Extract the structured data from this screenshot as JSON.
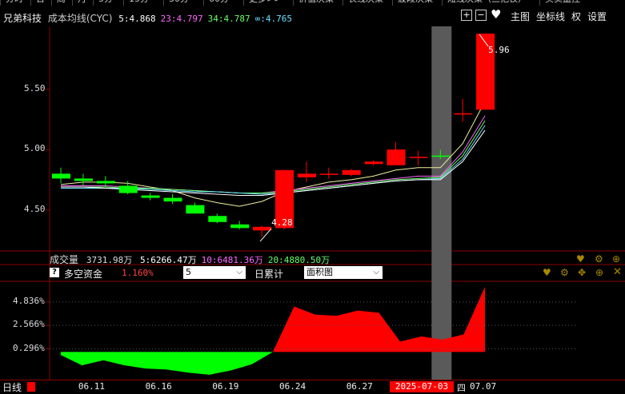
{
  "top_tabs": [
    "分时",
    "日",
    "周",
    "月",
    "5分",
    "15分",
    "30分",
    "60分",
    "更多>>",
    "价值决策",
    "长线决策",
    "波段决策",
    "短线决策（三把钗）",
    "买卖监控"
  ],
  "header": {
    "stock_name": "兄弟科技",
    "indicator_name": "成本均线(CYC)",
    "legend": [
      {
        "label": "5:4.868",
        "color": "#ffffff"
      },
      {
        "label": "23:4.797",
        "color": "#ff66ff"
      },
      {
        "label": "34:4.787",
        "color": "#66ff66"
      },
      {
        "label": "∞:4.765",
        "color": "#66e0ff"
      }
    ],
    "right_controls": {
      "plus": "+",
      "minus": "−",
      "heart": "♥",
      "main_chart": "主图",
      "axis": "坐标线",
      "rights": "权",
      "settings": "设置"
    }
  },
  "price_axis": {
    "labels": [
      "5.50",
      "5.00",
      "4.50"
    ]
  },
  "annotations": {
    "high": "5.96",
    "low": "4.28"
  },
  "volume": {
    "title": "成交量",
    "value": "3731.98万",
    "items": [
      {
        "label": "5:6266.47万",
        "color": "#ffffff"
      },
      {
        "label": "10:6481.36万",
        "color": "#ff66ff"
      },
      {
        "label": "20:4880.50万",
        "color": "#66ff66"
      }
    ]
  },
  "indicator": {
    "help": "?",
    "name": "多空资金",
    "value": "1.160%",
    "param": "5",
    "mode_label": "日累计",
    "chart_type": "面积图",
    "yaxis": [
      "4.836%",
      "2.566%",
      "0.296%"
    ]
  },
  "bottom": {
    "period_label": "日线",
    "dates": [
      "06.11",
      "06.16",
      "06.19",
      "06.24",
      "06.27"
    ],
    "selected_date": "2025-07-03",
    "selected_weekday": "四",
    "next_date": "07.07"
  },
  "colors": {
    "up": "#ff0000",
    "down": "#00ff00",
    "highlight": "#5a5a5a",
    "grid": "#8a0000"
  },
  "chart_data": {
    "type": "candlestick",
    "candles": [
      {
        "o": 4.8,
        "h": 4.85,
        "l": 4.72,
        "c": 4.76
      },
      {
        "o": 4.76,
        "h": 4.8,
        "l": 4.7,
        "c": 4.74
      },
      {
        "o": 4.74,
        "h": 4.78,
        "l": 4.69,
        "c": 4.72
      },
      {
        "o": 4.7,
        "h": 4.74,
        "l": 4.63,
        "c": 4.64
      },
      {
        "o": 4.62,
        "h": 4.64,
        "l": 4.58,
        "c": 4.6
      },
      {
        "o": 4.6,
        "h": 4.63,
        "l": 4.55,
        "c": 4.57
      },
      {
        "o": 4.54,
        "h": 4.56,
        "l": 4.47,
        "c": 4.47
      },
      {
        "o": 4.45,
        "h": 4.47,
        "l": 4.39,
        "c": 4.4
      },
      {
        "o": 4.38,
        "h": 4.41,
        "l": 4.34,
        "c": 4.35
      },
      {
        "o": 4.33,
        "h": 4.37,
        "l": 4.28,
        "c": 4.36
      },
      {
        "o": 4.35,
        "h": 4.83,
        "l": 4.34,
        "c": 4.83
      },
      {
        "o": 4.77,
        "h": 4.9,
        "l": 4.73,
        "c": 4.8
      },
      {
        "o": 4.79,
        "h": 4.85,
        "l": 4.76,
        "c": 4.8
      },
      {
        "o": 4.79,
        "h": 4.84,
        "l": 4.78,
        "c": 4.83
      },
      {
        "o": 4.88,
        "h": 4.91,
        "l": 4.87,
        "c": 4.9
      },
      {
        "o": 4.87,
        "h": 5.06,
        "l": 4.87,
        "c": 5.0
      },
      {
        "o": 4.93,
        "h": 4.99,
        "l": 4.87,
        "c": 4.94
      },
      {
        "o": 4.95,
        "h": 5.0,
        "l": 4.92,
        "c": 4.94
      },
      {
        "o": 5.3,
        "h": 5.42,
        "l": 5.23,
        "c": 5.3
      },
      {
        "o": 5.33,
        "h": 5.96,
        "l": 5.33,
        "c": 5.96
      }
    ],
    "ma_lines": [
      {
        "name": "5",
        "color": "#f0f0a0",
        "values": [
          4.71,
          4.73,
          4.73,
          4.72,
          4.69,
          4.66,
          4.6,
          4.56,
          4.53,
          4.57,
          4.65,
          4.69,
          4.73,
          4.75,
          4.78,
          4.83,
          4.85,
          4.85,
          5.05,
          5.4
        ]
      },
      {
        "name": "23",
        "color": "#ff66ff",
        "values": [
          4.7,
          4.7,
          4.7,
          4.69,
          4.68,
          4.67,
          4.66,
          4.65,
          4.64,
          4.64,
          4.66,
          4.68,
          4.7,
          4.72,
          4.74,
          4.76,
          4.78,
          4.78,
          4.98,
          5.28
        ]
      },
      {
        "name": "34",
        "color": "#66ff66",
        "values": [
          4.69,
          4.69,
          4.69,
          4.68,
          4.68,
          4.67,
          4.66,
          4.65,
          4.64,
          4.64,
          4.65,
          4.67,
          4.69,
          4.71,
          4.73,
          4.75,
          4.76,
          4.77,
          4.95,
          5.24
        ]
      },
      {
        "name": "∞",
        "color": "#66e0ff",
        "values": [
          4.68,
          4.68,
          4.68,
          4.68,
          4.67,
          4.66,
          4.65,
          4.65,
          4.64,
          4.63,
          4.64,
          4.66,
          4.68,
          4.7,
          4.72,
          4.74,
          4.75,
          4.76,
          4.92,
          5.2
        ]
      },
      {
        "name": "white",
        "color": "#ffffff",
        "values": [
          4.69,
          4.69,
          4.68,
          4.67,
          4.66,
          4.65,
          4.64,
          4.63,
          4.62,
          4.62,
          4.64,
          4.66,
          4.68,
          4.7,
          4.72,
          4.74,
          4.75,
          4.75,
          4.9,
          5.16
        ]
      }
    ],
    "money_flow": [
      -0.3,
      -1.3,
      -0.8,
      -1.3,
      -1.6,
      -1.7,
      -2.0,
      -2.2,
      -1.8,
      -1.2,
      0.0,
      4.4,
      3.6,
      3.5,
      4.0,
      3.8,
      1.0,
      1.5,
      1.2,
      1.7,
      6.3
    ],
    "ylim": [
      4.2,
      6.02
    ],
    "flow_ylim": [
      -2.6,
      6.6
    ]
  }
}
